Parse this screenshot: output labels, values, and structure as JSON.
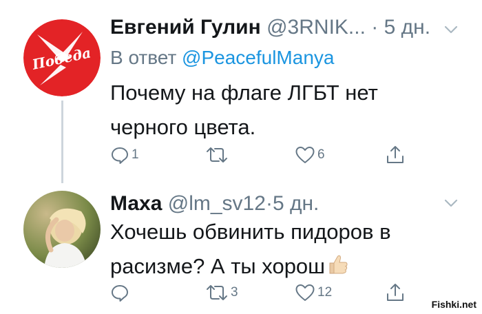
{
  "tweets": [
    {
      "author_name": "Евгений Гулин",
      "handle": "@3RNIK...",
      "separator": "·",
      "time": "5 дн.",
      "reply_prefix": "В ответ",
      "reply_to": "@PeacefulManya",
      "body_line1": "Почему на флаге ЛГБТ нет",
      "body_line2": "черного цвета.",
      "avatar_text": "Победа",
      "actions": {
        "reply_count": "1",
        "retweet_count": "",
        "like_count": "6"
      }
    },
    {
      "author_name": "Маха",
      "handle": "@lm_sv12",
      "separator": "·",
      "time": "5 дн.",
      "body_line1": "Хочешь обвинить пидоров в",
      "body_line2": "расизме? А ты хорош",
      "emoji": "thumbs-up",
      "actions": {
        "reply_count": "",
        "retweet_count": "3",
        "like_count": "12"
      }
    }
  ],
  "watermark": "Fishki.net",
  "colors": {
    "secondary_text": "#657786",
    "link": "#1b95e0",
    "avatar_red": "#e32326",
    "thread_line": "#cdd5dc"
  }
}
